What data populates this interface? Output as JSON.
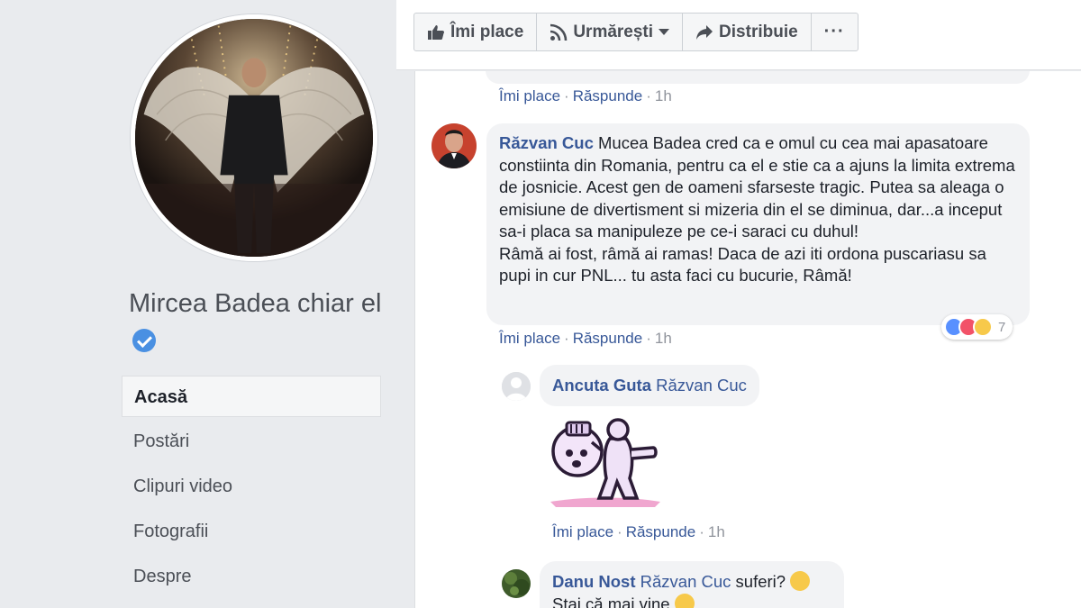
{
  "sidebar": {
    "page_name": "Mircea Badea chiar el",
    "verified_icon": "verified-check-icon",
    "nav": [
      {
        "label": "Acasă",
        "active": true
      },
      {
        "label": "Postări"
      },
      {
        "label": "Clipuri video"
      },
      {
        "label": "Fotografii"
      },
      {
        "label": "Despre"
      }
    ]
  },
  "action_bar": {
    "like": "Îmi place",
    "follow": "Urmărești",
    "share": "Distribuie",
    "more": "···"
  },
  "comment_actions": {
    "like": "Îmi place",
    "reply": "Răspunde",
    "sep": "·"
  },
  "comments": [
    {
      "time": "1h"
    },
    {
      "author": "Răzvan Cuc",
      "text": "Mucea Badea cred ca e omul cu cea mai apasatoare constiinta din Romania, pentru ca el e stie ca a ajuns la limita extrema de josnicie. Acest gen de oameni sfarseste tragic. Putea sa aleaga o emisiune de divertisment si mizeria din el se diminua, dar...a inceput sa-i placa sa manipuleze pe ce-i saraci cu duhul!",
      "text2": "Râmă ai fost, râmă ai ramas! Daca de azi iti ordona puscariasu sa pupi in cur PNL... tu asta faci cu bucurie, Râmă!",
      "time": "1h",
      "reaction_count": "7"
    },
    {
      "author": "Ancuta Guta",
      "mention": "Răzvan Cuc",
      "time": "1h"
    },
    {
      "author": "Danu Nost",
      "mention": "Răzvan Cuc",
      "text": "suferi?",
      "text2": "Stai că mai vine"
    }
  ],
  "colors": {
    "link": "#385898",
    "bubble": "#f2f3f5",
    "page_bg": "#e9ebee"
  }
}
